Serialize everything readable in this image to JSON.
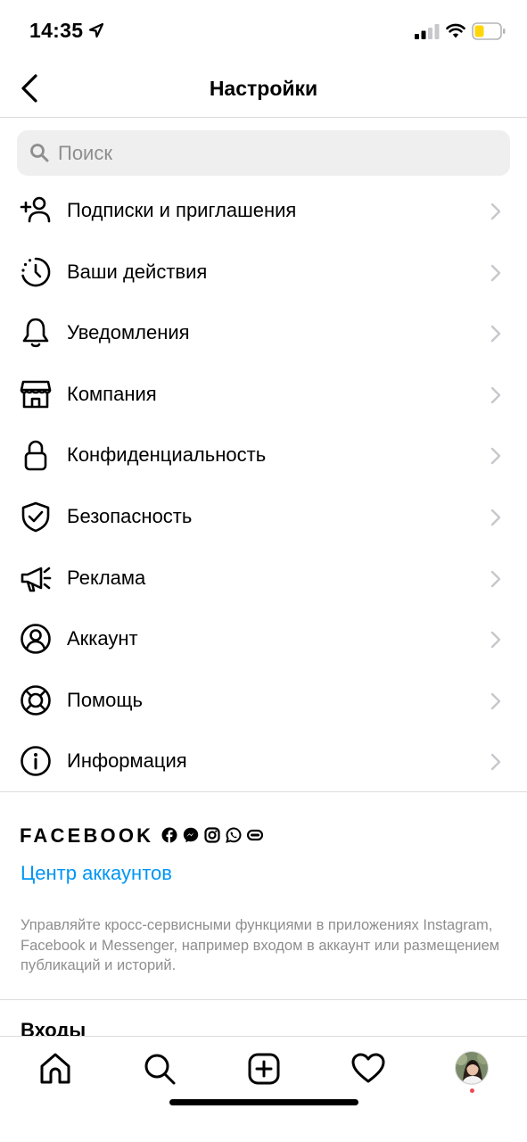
{
  "status_bar": {
    "time": "14:35",
    "signal_icon": "signal-icon",
    "wifi_icon": "wifi-icon",
    "battery_icon": "battery-low-icon",
    "battery_color": "#ffd60a"
  },
  "header": {
    "title": "Настройки",
    "back_icon": "chevron-left-icon"
  },
  "search": {
    "placeholder": "Поиск",
    "value": ""
  },
  "menu": {
    "items": [
      {
        "label": "Подписки и приглашения",
        "icon": "add-person-icon"
      },
      {
        "label": "Ваши действия",
        "icon": "activity-clock-icon"
      },
      {
        "label": "Уведомления",
        "icon": "bell-icon"
      },
      {
        "label": "Компания",
        "icon": "shop-icon"
      },
      {
        "label": "Конфиденциальность",
        "icon": "lock-icon"
      },
      {
        "label": "Безопасность",
        "icon": "shield-check-icon"
      },
      {
        "label": "Реклама",
        "icon": "megaphone-icon"
      },
      {
        "label": "Аккаунт",
        "icon": "account-circle-icon"
      },
      {
        "label": "Помощь",
        "icon": "lifebuoy-icon"
      },
      {
        "label": "Информация",
        "icon": "info-icon"
      }
    ]
  },
  "facebook": {
    "brand": "FACEBOOK",
    "app_icons": [
      "facebook-icon",
      "messenger-icon",
      "instagram-icon",
      "whatsapp-icon",
      "portal-icon"
    ],
    "link": "Центр аккаунтов",
    "description": "Управляйте кросс-сервисными функциями в приложениях Instagram, Facebook и Messenger, например входом в аккаунт или размещением публикаций и историй."
  },
  "logins": {
    "heading": "Входы"
  },
  "tab_bar": {
    "tabs": [
      "home-icon",
      "search-icon",
      "create-post-icon",
      "heart-icon",
      "profile-avatar"
    ],
    "notification_dot_color": "#ed4956"
  }
}
